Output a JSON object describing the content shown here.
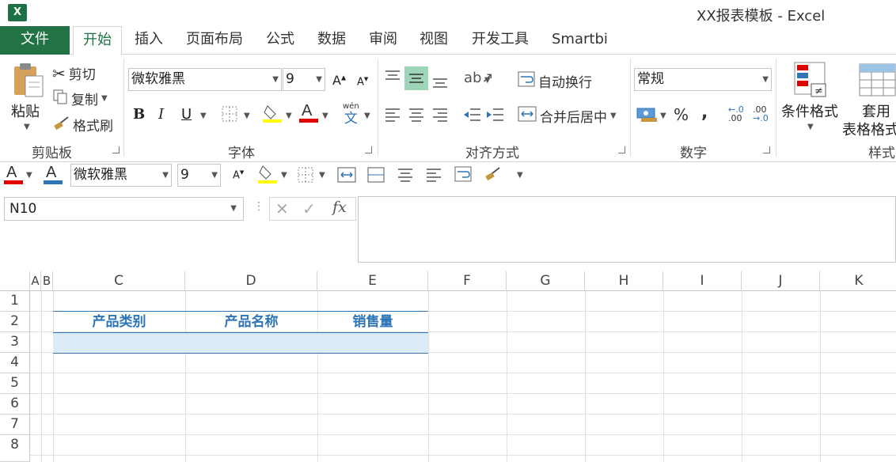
{
  "window": {
    "title": "XX报表模板 - Excel",
    "app_icon": "X"
  },
  "tabs": {
    "file": "文件",
    "items": [
      "开始",
      "插入",
      "页面布局",
      "公式",
      "数据",
      "审阅",
      "视图",
      "开发工具",
      "Smartbi"
    ],
    "active": "开始"
  },
  "ribbon": {
    "clipboard": {
      "label": "剪贴板",
      "paste": "粘贴",
      "cut": "剪切",
      "copy": "复制",
      "format_painter": "格式刷"
    },
    "font": {
      "label": "字体",
      "font_name": "微软雅黑",
      "font_size": "9",
      "bold": "B",
      "italic": "I",
      "underline": "U",
      "phonetic": "wén",
      "phonetic_char": "文"
    },
    "alignment": {
      "label": "对齐方式",
      "wrap_text": "自动换行",
      "merge_center": "合并后居中"
    },
    "number": {
      "label": "数字",
      "format": "常规",
      "percent": "%",
      "comma": ",",
      "inc_decimal": ".00",
      "dec_decimal": ".00"
    },
    "styles": {
      "label": "样式",
      "conditional_format": "条件格式",
      "format_as_table_1": "套用",
      "format_as_table_2": "表格格式"
    }
  },
  "quick_bar": {
    "font_name": "微软雅黑",
    "font_size": "9"
  },
  "formula_bar": {
    "name_box": "N10",
    "fx": "fx",
    "value": ""
  },
  "sheet": {
    "columns": [
      "A",
      "B",
      "C",
      "D",
      "E",
      "F",
      "G",
      "H",
      "I",
      "J",
      "K"
    ],
    "rows": [
      "1",
      "2",
      "3",
      "4",
      "5",
      "6",
      "7",
      "8"
    ],
    "header_row": [
      "产品类别",
      "产品名称",
      "销售量"
    ],
    "accent": "#2e75b6",
    "band_color": "#ddebf7"
  },
  "colors": {
    "excel_green": "#217346",
    "font_red": "#e00000",
    "highlight_yellow": "#ffff00"
  }
}
